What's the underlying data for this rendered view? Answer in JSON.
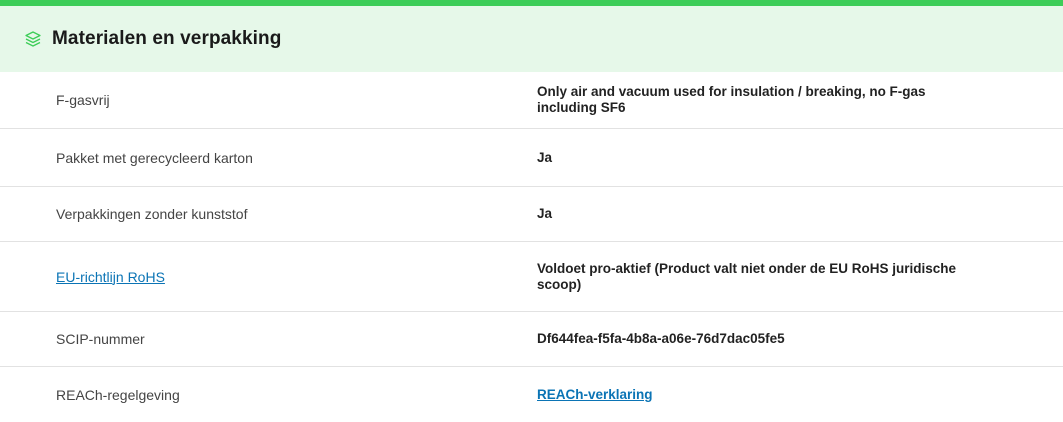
{
  "section": {
    "title": "Materialen en verpakking",
    "icon": "layers-icon",
    "accent": "#3dcd58",
    "header_bg": "#e6f8e9",
    "link_color": "#0b74b5"
  },
  "rows": [
    {
      "label": "F-gasvrij",
      "value": "Only air and vacuum used for insulation / breaking, no F-gas including SF6"
    },
    {
      "label": "Pakket met gerecycleerd karton",
      "value": "Ja"
    },
    {
      "label": "Verpakkingen zonder kunststof",
      "value": "Ja"
    },
    {
      "label": "EU-richtlijn RoHS",
      "value": "Voldoet pro-aktief (Product valt niet onder de EU RoHS juridische scoop)"
    },
    {
      "label": "SCIP-nummer",
      "value": "Df644fea-f5fa-4b8a-a06e-76d7dac05fe5"
    },
    {
      "label": "REACh-regelgeving",
      "value": "REACh-verklaring"
    }
  ]
}
